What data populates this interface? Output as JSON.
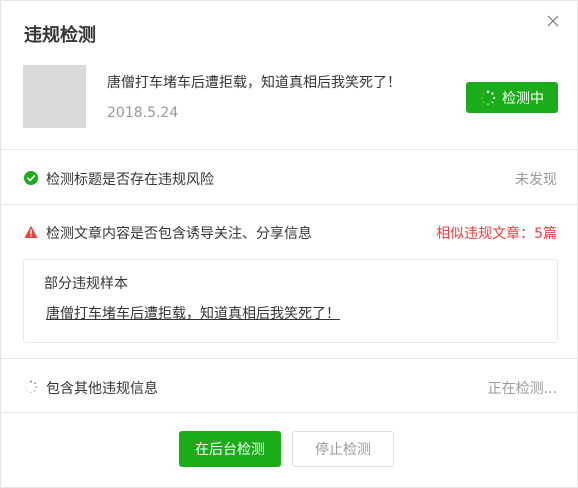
{
  "dialog": {
    "title": "违规检测",
    "close_icon": "close-icon"
  },
  "article": {
    "title": "唐僧打车堵车后遭拒载，知道真相后我笑死了！",
    "date": "2018.5.24",
    "status_button": "检测中",
    "status_icon": "spinner-icon"
  },
  "checks": [
    {
      "icon": "check-circle-icon",
      "label": "检测标题是否存在违规风险",
      "status": "未发现",
      "status_color": "#9a9a9a",
      "icon_color": "#1aad19"
    },
    {
      "icon": "warning-icon",
      "label": "检测文章内容是否包含诱导关注、分享信息",
      "status": "相似违规文章：5篇",
      "status_color": "#e64340",
      "icon_color": "#e64340"
    },
    {
      "icon": "spinner-icon",
      "label": "包含其他违规信息",
      "status": "正在检测...",
      "status_color": "#9a9a9a"
    }
  ],
  "sample": {
    "title": "部分违规样本",
    "link": "唐僧打车堵车后遭拒载，知道真相后我笑死了！"
  },
  "footer": {
    "primary_button": "在后台检测",
    "secondary_button": "停止检测"
  },
  "colors": {
    "accent": "#1aad19",
    "danger": "#e64340"
  }
}
